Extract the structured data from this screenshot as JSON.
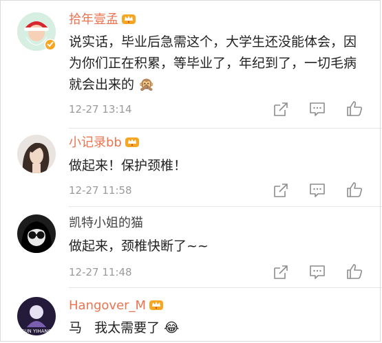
{
  "comments": [
    {
      "username": "拾年壹孟",
      "verified": true,
      "body": "说实话，毕业后急需这个，大学生还没能体会，因为你们正在积累，等毕业了，年纪到了，一切毛病就会出来的",
      "emoji": "🙊",
      "time": "12-27 13:14"
    },
    {
      "username": "小记录bb",
      "verified": false,
      "body": "做起来！保护颈椎！",
      "emoji": "",
      "time": "12-27 11:58"
    },
    {
      "username": "凯特小姐的猫",
      "verified": false,
      "body": "做起来，颈椎快断了~~",
      "emoji": "",
      "time": "12-27 11:48"
    },
    {
      "username": "Hangover_M",
      "verified": false,
      "body": "马   我太需要了",
      "emoji": "😂",
      "time": ""
    }
  ],
  "icons": [
    "share-icon",
    "comment-icon",
    "like-icon"
  ],
  "colors": {
    "username": "#eb7350",
    "timestamp": "#9a9a9a",
    "icon": "#8c8c8c",
    "vip_badge": "#f5a623"
  }
}
